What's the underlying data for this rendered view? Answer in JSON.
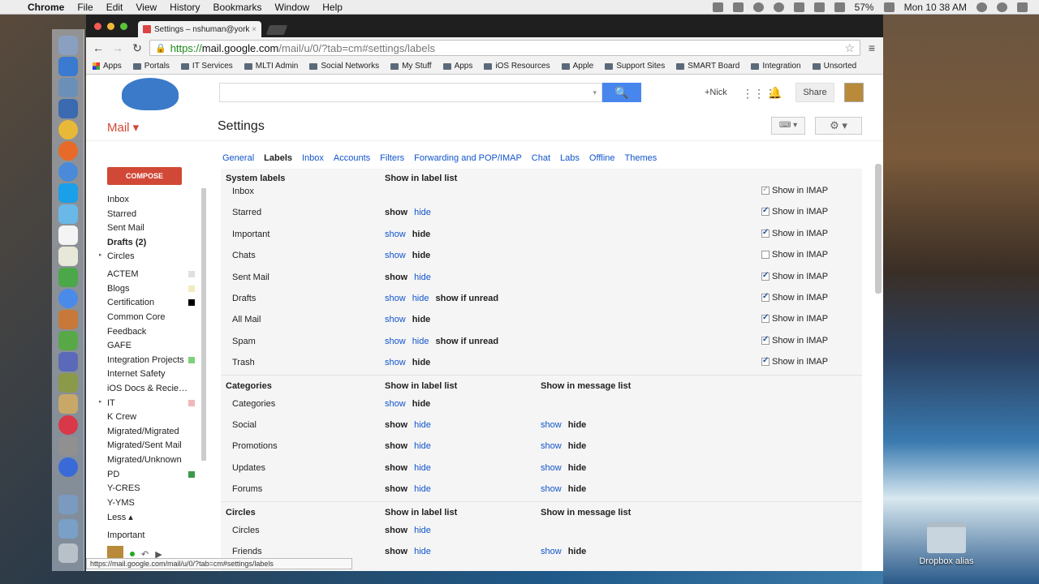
{
  "menubar": {
    "apple": "",
    "app": "Chrome",
    "menus": [
      "File",
      "Edit",
      "View",
      "History",
      "Bookmarks",
      "Window",
      "Help"
    ],
    "battery": "57%",
    "clock": "Mon 10 38 AM"
  },
  "browser": {
    "tab_title": "Settings – nshuman@york",
    "tab_close": "×",
    "url_scheme": "https://",
    "url_host": "mail.google.com",
    "url_path": "/mail/u/0/?tab=cm#settings/labels",
    "star": "☆",
    "menu": "≡",
    "back": "←",
    "forward": "→",
    "reload": "↻"
  },
  "bookmarks": [
    {
      "label": "Apps",
      "icon": "apps-icon"
    },
    {
      "label": "Portals",
      "icon": "folder-icon"
    },
    {
      "label": "IT Services",
      "icon": "folder-icon"
    },
    {
      "label": "MLTI Admin",
      "icon": "folder-icon"
    },
    {
      "label": "Social Networks",
      "icon": "folder-icon"
    },
    {
      "label": "My Stuff",
      "icon": "folder-icon"
    },
    {
      "label": "Apps",
      "icon": "folder-icon"
    },
    {
      "label": "iOS Resources",
      "icon": "folder-icon"
    },
    {
      "label": "Apple",
      "icon": "folder-icon"
    },
    {
      "label": "Support Sites",
      "icon": "folder-icon"
    },
    {
      "label": "SMART Board",
      "icon": "folder-icon"
    },
    {
      "label": "Integration",
      "icon": "folder-icon"
    },
    {
      "label": "Unsorted",
      "icon": "folder-icon"
    }
  ],
  "header": {
    "search_icon": "🔍",
    "search_caret": "▾",
    "plus_nick": "+Nick",
    "apps_icon": "⋮⋮⋮",
    "bell_icon": "🔔",
    "share": "Share"
  },
  "subheader": {
    "mail": "Mail ▾",
    "title": "Settings",
    "keyboard": "⌨ ▾",
    "gear": "⚙ ▾"
  },
  "sidebar": {
    "compose": "COMPOSE",
    "items": [
      {
        "label": "Inbox",
        "bold": false
      },
      {
        "label": "Starred",
        "bold": false
      },
      {
        "label": "Sent Mail",
        "bold": false
      },
      {
        "label": "Drafts (2)",
        "bold": true
      },
      {
        "label": "Circles",
        "bold": false,
        "arrow": "▸"
      },
      {
        "label": "ACTEM",
        "swatch": "#e0e0e0"
      },
      {
        "label": "Blogs",
        "swatch": "#f0ecc0"
      },
      {
        "label": "Certification",
        "swatch": "#000000"
      },
      {
        "label": "Common Core"
      },
      {
        "label": "Feedback"
      },
      {
        "label": "GAFE"
      },
      {
        "label": "Integration Projects",
        "swatch": "#7ed07e"
      },
      {
        "label": "Internet Safety"
      },
      {
        "label": "iOS Docs & Recie…"
      },
      {
        "label": "IT",
        "arrow": "▸",
        "swatch": "#f0b8b8"
      },
      {
        "label": "K Crew"
      },
      {
        "label": "Migrated/Migrated"
      },
      {
        "label": "Migrated/Sent Mail"
      },
      {
        "label": "Migrated/Unknown"
      },
      {
        "label": "PD",
        "swatch": "#3a9a4a"
      },
      {
        "label": "Y-CRES"
      },
      {
        "label": "Y-YMS"
      },
      {
        "label": "Less ▴"
      },
      {
        "label": "Important"
      }
    ],
    "phone_icon": "↶",
    "video_icon": "▶"
  },
  "settings_tabs": [
    {
      "label": "General",
      "active": false
    },
    {
      "label": "Labels",
      "active": true
    },
    {
      "label": "Inbox",
      "active": false
    },
    {
      "label": "Accounts",
      "active": false
    },
    {
      "label": "Filters",
      "active": false
    },
    {
      "label": "Forwarding and POP/IMAP",
      "active": false
    },
    {
      "label": "Chat",
      "active": false
    },
    {
      "label": "Labs",
      "active": false
    },
    {
      "label": "Offline",
      "active": false
    },
    {
      "label": "Themes",
      "active": false
    }
  ],
  "labels": {
    "system_header": {
      "c1": "System labels",
      "c2": "Show in label list"
    },
    "system": [
      {
        "name": "Inbox",
        "opts": [],
        "imap": "dim"
      },
      {
        "name": "Starred",
        "opts": [
          {
            "t": "show",
            "cur": true
          },
          {
            "t": "hide"
          }
        ],
        "imap": "on"
      },
      {
        "name": "Important",
        "opts": [
          {
            "t": "show"
          },
          {
            "t": "hide",
            "cur": true
          }
        ],
        "imap": "on"
      },
      {
        "name": "Chats",
        "opts": [
          {
            "t": "show"
          },
          {
            "t": "hide",
            "cur": true
          }
        ],
        "imap": "off"
      },
      {
        "name": "Sent Mail",
        "opts": [
          {
            "t": "show",
            "cur": true
          },
          {
            "t": "hide"
          }
        ],
        "imap": "on"
      },
      {
        "name": "Drafts",
        "opts": [
          {
            "t": "show"
          },
          {
            "t": "hide"
          },
          {
            "t": "show if unread",
            "cur": true
          }
        ],
        "imap": "on"
      },
      {
        "name": "All Mail",
        "opts": [
          {
            "t": "show"
          },
          {
            "t": "hide",
            "cur": true
          }
        ],
        "imap": "on"
      },
      {
        "name": "Spam",
        "opts": [
          {
            "t": "show"
          },
          {
            "t": "hide"
          },
          {
            "t": "show if unread",
            "cur": true
          }
        ],
        "imap": "on"
      },
      {
        "name": "Trash",
        "opts": [
          {
            "t": "show"
          },
          {
            "t": "hide",
            "cur": true
          }
        ],
        "imap": "on"
      }
    ],
    "imap_label": "Show in IMAP",
    "categories_header": {
      "c1": "Categories",
      "c2": "Show in label list",
      "c3": "Show in message list"
    },
    "categories": [
      {
        "name": "Categories",
        "opts": [
          {
            "t": "show"
          },
          {
            "t": "hide",
            "cur": true
          }
        ],
        "msg": []
      },
      {
        "name": "Social",
        "opts": [
          {
            "t": "show",
            "cur": true
          },
          {
            "t": "hide"
          }
        ],
        "msg": [
          {
            "t": "show"
          },
          {
            "t": "hide",
            "cur": true
          }
        ]
      },
      {
        "name": "Promotions",
        "opts": [
          {
            "t": "show",
            "cur": true
          },
          {
            "t": "hide"
          }
        ],
        "msg": [
          {
            "t": "show"
          },
          {
            "t": "hide",
            "cur": true
          }
        ]
      },
      {
        "name": "Updates",
        "opts": [
          {
            "t": "show",
            "cur": true
          },
          {
            "t": "hide"
          }
        ],
        "msg": [
          {
            "t": "show"
          },
          {
            "t": "hide",
            "cur": true
          }
        ]
      },
      {
        "name": "Forums",
        "opts": [
          {
            "t": "show",
            "cur": true
          },
          {
            "t": "hide"
          }
        ],
        "msg": [
          {
            "t": "show"
          },
          {
            "t": "hide",
            "cur": true
          }
        ]
      }
    ],
    "circles_header": {
      "c1": "Circles",
      "c2": "Show in label list",
      "c3": "Show in message list"
    },
    "circles": [
      {
        "name": "Circles",
        "opts": [
          {
            "t": "show",
            "cur": true
          },
          {
            "t": "hide"
          }
        ],
        "msg": []
      },
      {
        "name": "Friends",
        "opts": [
          {
            "t": "show",
            "cur": true
          },
          {
            "t": "hide"
          }
        ],
        "msg": [
          {
            "t": "show"
          },
          {
            "t": "hide",
            "cur": true
          }
        ]
      }
    ]
  },
  "status_url": "https://mail.google.com/mail/u/0/?tab=cm#settings/labels",
  "desktop": {
    "dropbox": "Dropbox alias"
  },
  "colors": {
    "accent_red": "#d14836",
    "link_blue": "#1155cc",
    "search_blue": "#4787ed"
  }
}
